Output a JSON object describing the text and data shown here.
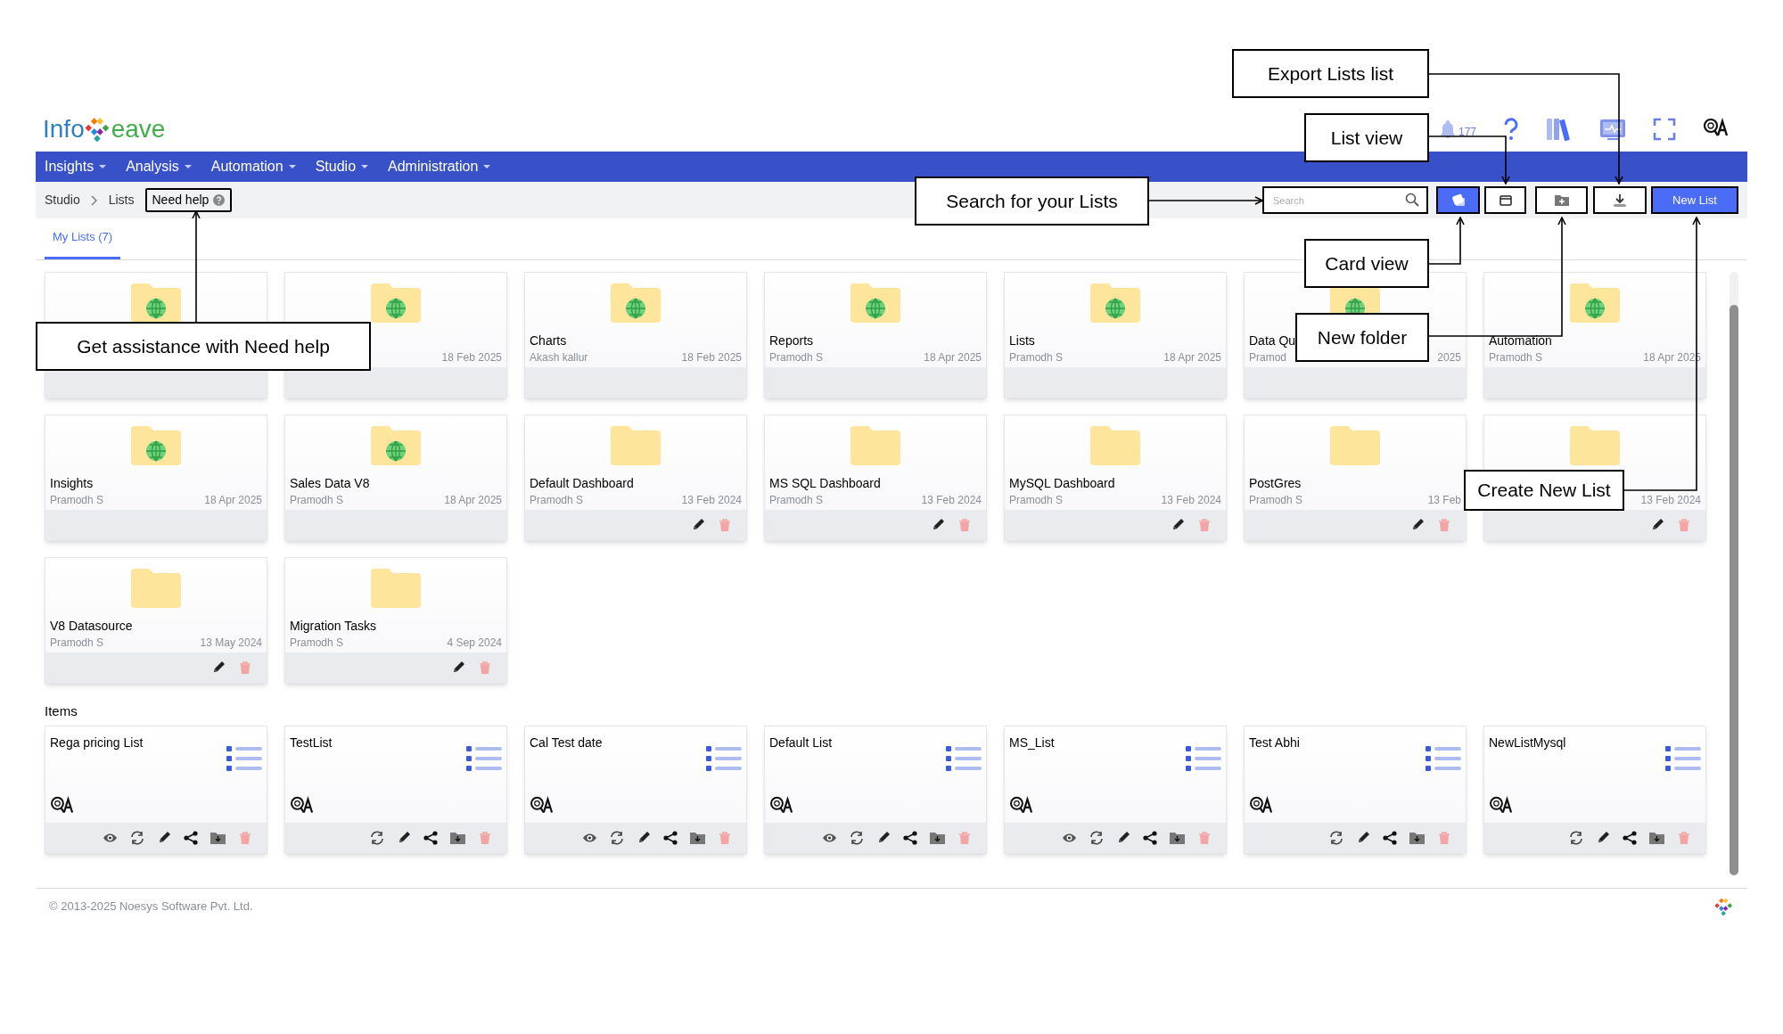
{
  "logo": {
    "text_left": "Info",
    "text_right": "eave"
  },
  "notifications": {
    "count": "177"
  },
  "nav": [
    {
      "label": "Insights"
    },
    {
      "label": "Analysis"
    },
    {
      "label": "Automation"
    },
    {
      "label": "Studio"
    },
    {
      "label": "Administration"
    }
  ],
  "breadcrumb": [
    "Studio",
    "Lists"
  ],
  "help_button": "Need help",
  "search": {
    "placeholder": "Search"
  },
  "view_toggle": [
    {
      "kind": "card",
      "selected": true
    },
    {
      "kind": "list",
      "selected": false
    }
  ],
  "new_list_button": "New List",
  "tabs": [
    {
      "label": "My Lists (7)",
      "selected": true
    }
  ],
  "folders": [
    {
      "shared": true,
      "editable": false
    },
    {
      "date": "18 Feb 2025",
      "shared": true,
      "editable": false
    },
    {
      "name": "Charts",
      "owner": "Akash kallur",
      "date": "18 Feb 2025",
      "shared": true,
      "editable": false
    },
    {
      "name": "Reports",
      "owner": "Pramodh S",
      "date": "18 Apr 2025",
      "shared": true,
      "editable": false
    },
    {
      "name": "Lists",
      "owner": "Pramodh S",
      "date": "18 Apr 2025",
      "shared": true,
      "editable": false
    },
    {
      "name": "Data Qu",
      "owner": "Pramod",
      "date": "2025",
      "shared": true,
      "editable": false
    },
    {
      "name": "Automation",
      "owner": "Pramodh S",
      "date": "18 Apr 2025",
      "shared": true,
      "editable": false
    },
    {
      "name": "Insights",
      "owner": "Pramodh S",
      "date": "18 Apr 2025",
      "shared": true,
      "editable": false
    },
    {
      "name": "Sales Data V8",
      "owner": "Pramodh S",
      "date": "18 Apr 2025",
      "shared": true,
      "editable": false
    },
    {
      "name": "Default Dashboard",
      "owner": "Pramodh S",
      "date": "13 Feb 2024",
      "shared": false,
      "editable": true
    },
    {
      "name": "MS SQL Dashboard",
      "owner": "Pramodh S",
      "date": "13 Feb 2024",
      "shared": false,
      "editable": true
    },
    {
      "name": "MySQL Dashboard",
      "owner": "Pramodh S",
      "date": "13 Feb 2024",
      "shared": false,
      "editable": true
    },
    {
      "name": "PostGres",
      "owner": "Pramodh S",
      "date": "13 Feb",
      "shared": false,
      "editable": true
    },
    {
      "date": "13 Feb 2024",
      "shared": false,
      "editable": true
    },
    {
      "name": "V8 Datasource",
      "owner": "Pramodh S",
      "date": "13 May 2024",
      "shared": false,
      "editable": true
    },
    {
      "name": "Migration Tasks",
      "owner": "Pramodh S",
      "date": "4 Sep 2024",
      "shared": false,
      "editable": true
    }
  ],
  "items_heading": "Items",
  "items": [
    {
      "name": "Rega pricing List",
      "viewable": true
    },
    {
      "name": "TestList",
      "viewable": false
    },
    {
      "name": "Cal Test date",
      "viewable": true
    },
    {
      "name": "Default List",
      "viewable": true
    },
    {
      "name": "MS_List",
      "viewable": true
    },
    {
      "name": "Test Abhi",
      "viewable": false
    },
    {
      "name": "NewListMysql",
      "viewable": false
    }
  ],
  "footer": "© 2013-2025 Noesys Software Pvt. Ltd.",
  "annotations": [
    {
      "text": "Export Lists list"
    },
    {
      "text": "List view"
    },
    {
      "text": "Search for your Lists"
    },
    {
      "text": "Card view"
    },
    {
      "text": "New folder"
    },
    {
      "text": "Create New List"
    },
    {
      "text": "Get assistance with Need help"
    }
  ]
}
